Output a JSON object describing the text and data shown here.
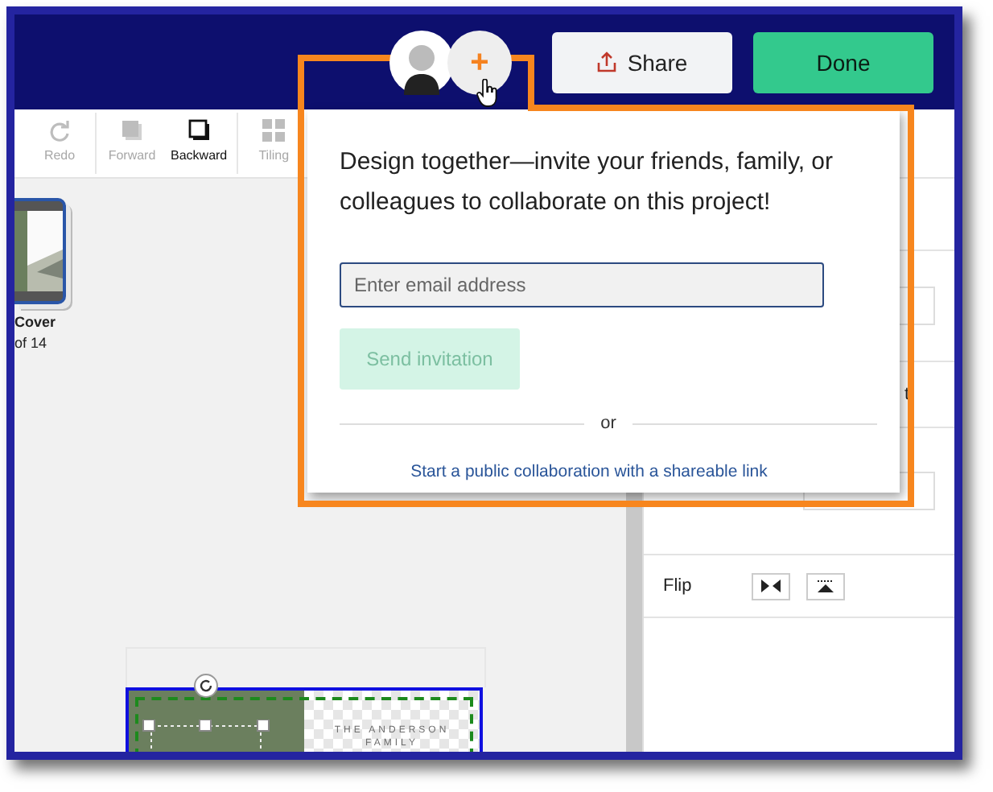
{
  "header": {
    "share_button": "Share",
    "done_button": "Done",
    "add_collaborator": "+"
  },
  "toolbar": [
    {
      "label": "Redo",
      "kind": "redo",
      "disabled": true
    },
    {
      "label": "Forward",
      "kind": "forward",
      "disabled": true
    },
    {
      "label": "Backward",
      "kind": "backward",
      "disabled": false
    },
    {
      "label": "Tiling",
      "kind": "tiling",
      "disabled": true
    }
  ],
  "pages": {
    "title": "Cover",
    "count": "of 14"
  },
  "canvas": {
    "card_text": "THE ANDERSON FAMILY"
  },
  "properties": {
    "fragment": "t",
    "flip_label": "Flip"
  },
  "invite_popup": {
    "message": "Design together—invite your friends, family, or colleagues to collaborate on this project!",
    "email": {
      "placeholder": "Enter email address"
    },
    "send_button": {
      "label": "Send invitation",
      "disabled": true
    },
    "separator": "or",
    "link": "Start a public collaboration with a shareable link"
  }
}
